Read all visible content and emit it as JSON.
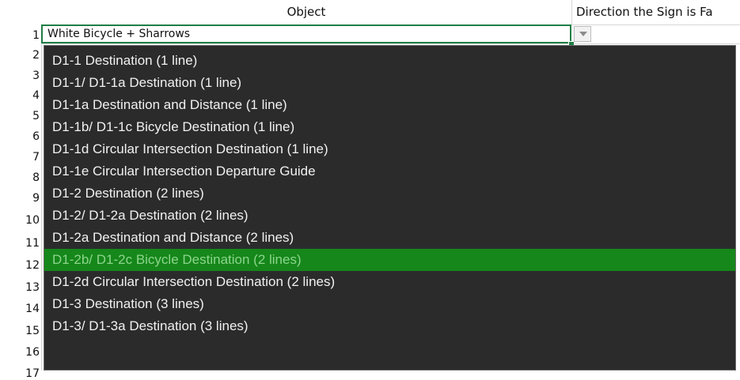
{
  "headers": {
    "object": "Object",
    "direction": "Direction the Sign is Fa"
  },
  "row_numbers": [
    "1",
    "2",
    "3",
    "4",
    "5",
    "6",
    "7",
    "8",
    "9",
    "10",
    "11",
    "12",
    "13",
    "14",
    "15",
    "16",
    "17"
  ],
  "active_cell": {
    "value": "White Bicycle + Sharrows"
  },
  "dropdown": {
    "icon": "chevron-down-icon",
    "selected_index": 9,
    "options": [
      "D1-1 Destination (1 line)",
      "D1-1/ D1-1a Destination (1 line)",
      "D1-1a Destination and Distance (1 line)",
      "D1-1b/ D1-1c Bicycle Destination (1 line)",
      "D1-1d Circular Intersection Destination (1 line)",
      "D1-1e Circular Intersection Departure Guide",
      "D1-2 Destination (2 lines)",
      "D1-2/ D1-2a Destination (2 lines)",
      "D1-2a Destination and Distance (2 lines)",
      "D1-2b/ D1-2c Bicycle Destination (2 lines)",
      "D1-2d Circular Intersection Destination (2 lines)",
      "D1-3 Destination (3 lines)",
      "D1-3/ D1-3a Destination (3 lines)"
    ]
  },
  "colors": {
    "selection_green": "#16871a",
    "active_cell_border": "#1e7e45",
    "listbox_background": "#2b2b2c"
  }
}
